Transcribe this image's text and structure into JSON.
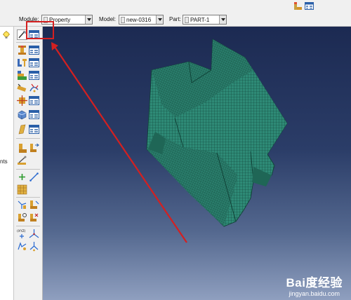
{
  "context_bar": {
    "module_label": "Module:",
    "module_value": "Property",
    "model_label": "Model:",
    "model_value": "new-0316",
    "part_label": "Part:",
    "part_value": "PART-1"
  },
  "left_panel": {
    "partial_text": "nts"
  },
  "toolbox": {
    "icons": [
      "create-material-icon",
      "material-manager-icon",
      "create-section-icon",
      "section-manager-icon",
      "create-profile-icon",
      "profile-manager-icon",
      "assign-section-icon",
      "section-assignment-manager-icon",
      "assign-beam-orientation-icon",
      "assign-normal-icon",
      "assign-rebar-icon",
      "stringer-icon",
      "skin-icon",
      "skin-manager-icon",
      "composite-layup-icon",
      "layup-manager-icon",
      "assign-orientation-icon",
      "orientation-manager-icon",
      "special-icon",
      "engineering-feature-icon",
      "inertia-icon",
      "datum-point-icon",
      "datum-axis-icon",
      "partition-icon",
      "create-datum-csys-icon",
      "datum-plane-icon",
      "query-icon",
      "view-icon",
      "xyz-csys-icon",
      "triad-icon",
      "rotate-icon",
      "transform-icon"
    ]
  },
  "watermark": {
    "line1": "Bai度经验",
    "line2": "jingyan.baidu.com"
  },
  "colors": {
    "mesh": "#2e8a76",
    "mesh_dark": "#1f6656",
    "annotation": "#d42020",
    "viewport_top": "#1c2a52",
    "viewport_bottom": "#8f9fbf"
  }
}
